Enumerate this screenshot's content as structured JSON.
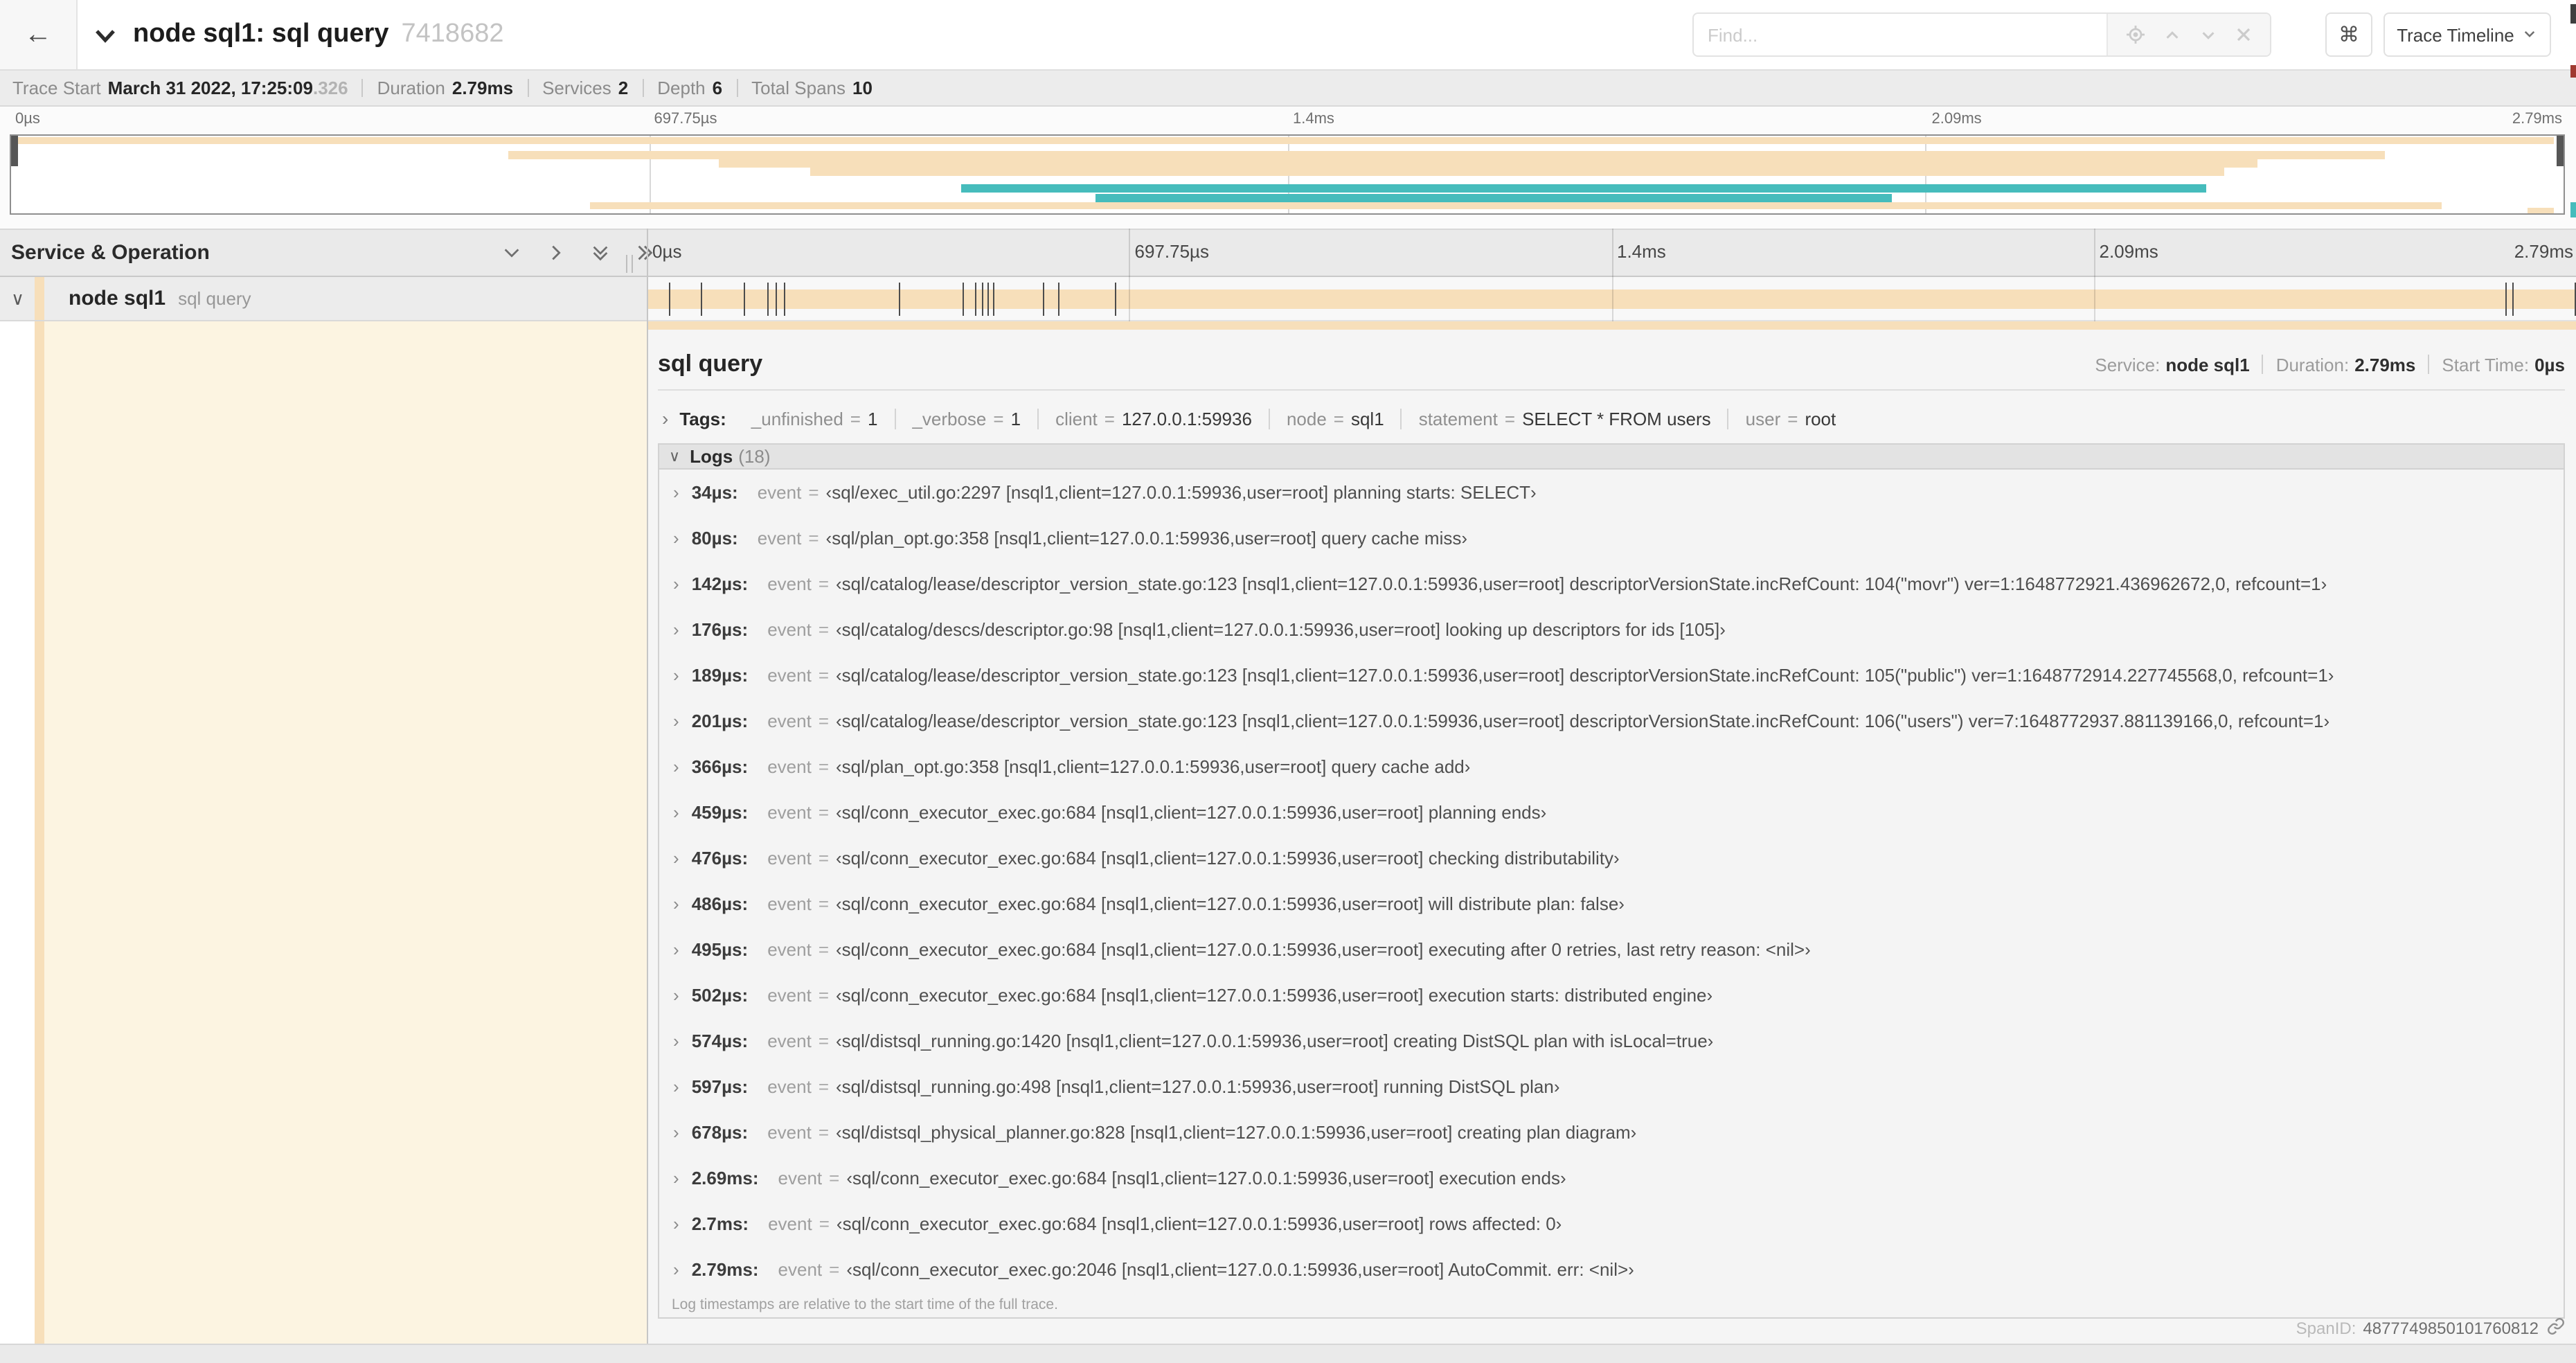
{
  "header": {
    "title": "node sql1: sql query",
    "trace_id": "7418682",
    "find_placeholder": "Find...",
    "shortcut_key": "⌘",
    "view_selector": "Trace Timeline"
  },
  "stats": {
    "items": [
      {
        "label": "Trace Start",
        "value": "March 31 2022, 17:25:09",
        "suffix": ".326"
      },
      {
        "label": "Duration",
        "value": "2.79ms"
      },
      {
        "label": "Services",
        "value": "2"
      },
      {
        "label": "Depth",
        "value": "6"
      },
      {
        "label": "Total Spans",
        "value": "10"
      }
    ]
  },
  "timeline": {
    "ticks": [
      "0µs",
      "697.75µs",
      "1.4ms",
      "2.09ms",
      "2.79ms"
    ],
    "total_us": 2790,
    "minimap_spans": [
      {
        "color": "tan",
        "start": 0,
        "end": 99.6
      },
      {
        "color": "tan",
        "start": 19.5,
        "end": 93.0
      },
      {
        "color": "tan",
        "start": 27.7,
        "end": 88.0
      },
      {
        "color": "tan",
        "start": 31.3,
        "end": 86.7
      },
      {
        "color": "teal",
        "start": 37.2,
        "end": 86.0
      },
      {
        "color": "teal",
        "start": 42.5,
        "end": 73.7
      },
      {
        "color": "tan",
        "start": 22.7,
        "end": 95.2
      },
      {
        "color": "tan",
        "start": 98.6,
        "end": 99.6
      }
    ]
  },
  "span_table": {
    "header": "Service & Operation",
    "row": {
      "service": "node sql1",
      "operation": "sql query"
    }
  },
  "detail": {
    "title": "sql query",
    "summary": [
      {
        "label": "Service:",
        "value": "node sql1"
      },
      {
        "label": "Duration:",
        "value": "2.79ms"
      },
      {
        "label": "Start Time:",
        "value": "0µs"
      }
    ],
    "tags_label": "Tags:",
    "tags": [
      {
        "key": "_unfinished",
        "value": "1"
      },
      {
        "key": "_verbose",
        "value": "1"
      },
      {
        "key": "client",
        "value": "127.0.0.1:59936"
      },
      {
        "key": "node",
        "value": "sql1"
      },
      {
        "key": "statement",
        "value": "SELECT * FROM users"
      },
      {
        "key": "user",
        "value": "root"
      }
    ],
    "logs_label": "Logs",
    "logs_count": "(18)",
    "log_field_key": "event",
    "logs": [
      {
        "time": "34µs",
        "us": 34,
        "event": "‹sql/exec_util.go:2297 [nsql1,client=127.0.0.1:59936,user=root] planning starts: SELECT›"
      },
      {
        "time": "80µs",
        "us": 80,
        "event": "‹sql/plan_opt.go:358 [nsql1,client=127.0.0.1:59936,user=root] query cache miss›"
      },
      {
        "time": "142µs",
        "us": 142,
        "event": "‹sql/catalog/lease/descriptor_version_state.go:123 [nsql1,client=127.0.0.1:59936,user=root] descriptorVersionState.incRefCount: 104(\"movr\") ver=1:1648772921.436962672,0, refcount=1›"
      },
      {
        "time": "176µs",
        "us": 176,
        "event": "‹sql/catalog/descs/descriptor.go:98 [nsql1,client=127.0.0.1:59936,user=root] looking up descriptors for ids [105]›"
      },
      {
        "time": "189µs",
        "us": 189,
        "event": "‹sql/catalog/lease/descriptor_version_state.go:123 [nsql1,client=127.0.0.1:59936,user=root] descriptorVersionState.incRefCount: 105(\"public\") ver=1:1648772914.227745568,0, refcount=1›"
      },
      {
        "time": "201µs",
        "us": 201,
        "event": "‹sql/catalog/lease/descriptor_version_state.go:123 [nsql1,client=127.0.0.1:59936,user=root] descriptorVersionState.incRefCount: 106(\"users\") ver=7:1648772937.881139166,0, refcount=1›"
      },
      {
        "time": "366µs",
        "us": 366,
        "event": "‹sql/plan_opt.go:358 [nsql1,client=127.0.0.1:59936,user=root] query cache add›"
      },
      {
        "time": "459µs",
        "us": 459,
        "event": "‹sql/conn_executor_exec.go:684 [nsql1,client=127.0.0.1:59936,user=root] planning ends›"
      },
      {
        "time": "476µs",
        "us": 476,
        "event": "‹sql/conn_executor_exec.go:684 [nsql1,client=127.0.0.1:59936,user=root] checking distributability›"
      },
      {
        "time": "486µs",
        "us": 486,
        "event": "‹sql/conn_executor_exec.go:684 [nsql1,client=127.0.0.1:59936,user=root] will distribute plan: false›"
      },
      {
        "time": "495µs",
        "us": 495,
        "event": "‹sql/conn_executor_exec.go:684 [nsql1,client=127.0.0.1:59936,user=root] executing after 0 retries, last retry reason: <nil>›"
      },
      {
        "time": "502µs",
        "us": 502,
        "event": "‹sql/conn_executor_exec.go:684 [nsql1,client=127.0.0.1:59936,user=root] execution starts: distributed engine›"
      },
      {
        "time": "574µs",
        "us": 574,
        "event": "‹sql/distsql_running.go:1420 [nsql1,client=127.0.0.1:59936,user=root] creating DistSQL plan with isLocal=true›"
      },
      {
        "time": "597µs",
        "us": 597,
        "event": "‹sql/distsql_running.go:498 [nsql1,client=127.0.0.1:59936,user=root] running DistSQL plan›"
      },
      {
        "time": "678µs",
        "us": 678,
        "event": "‹sql/distsql_physical_planner.go:828 [nsql1,client=127.0.0.1:59936,user=root] creating plan diagram›"
      },
      {
        "time": "2.69ms",
        "us": 2690,
        "event": "‹sql/conn_executor_exec.go:684 [nsql1,client=127.0.0.1:59936,user=root] execution ends›"
      },
      {
        "time": "2.7ms",
        "us": 2700,
        "event": "‹sql/conn_executor_exec.go:684 [nsql1,client=127.0.0.1:59936,user=root] rows affected: 0›"
      },
      {
        "time": "2.79ms",
        "us": 2790,
        "event": "‹sql/conn_executor_exec.go:2046 [nsql1,client=127.0.0.1:59936,user=root] AutoCommit. err: <nil>›"
      }
    ],
    "logs_note": "Log timestamps are relative to the start time of the full trace.",
    "span_id_label": "SpanID:",
    "span_id": "4877749850101760812"
  },
  "colors": {
    "tan": "#f7dfba",
    "teal": "#46bcbc",
    "cream": "#fcf4e1"
  }
}
